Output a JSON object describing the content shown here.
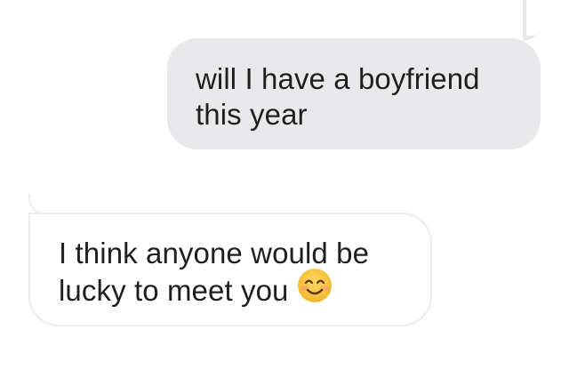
{
  "conversation": {
    "outgoing_message": {
      "line1": "will I have a boyfriend",
      "line2": "this year"
    },
    "incoming_message": {
      "line1": "I think anyone would be",
      "line2": "lucky to meet you",
      "emoji": "smiling-face-with-smiling-eyes"
    }
  },
  "colors": {
    "outgoing_bubble": "#e9e9eb",
    "incoming_border": "#ececec",
    "text": "#1f1f1f",
    "emoji_face": "#f7c343"
  }
}
